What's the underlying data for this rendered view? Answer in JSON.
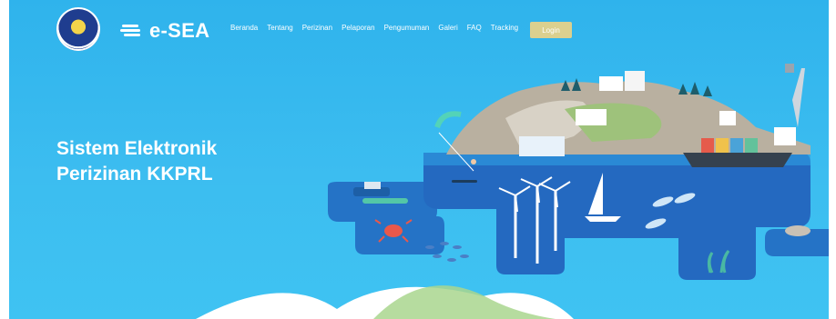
{
  "header": {
    "brand": "e-SEA",
    "nav": [
      "Beranda",
      "Tentang",
      "Perizinan",
      "Pelaporan",
      "Pengumuman",
      "Galeri",
      "FAQ",
      "Tracking"
    ],
    "login_label": "Login"
  },
  "hero": {
    "title_line1": "Sistem Elektronik",
    "title_line2": "Perizinan KKPRL"
  },
  "colors": {
    "sky": "#2fb3ec",
    "login_button": "#dbd08f",
    "sea_dark": "#2573c6",
    "sea_light": "#2d8ee0",
    "land": "#b9b0a0"
  },
  "icons": [
    "emblem-logo",
    "brand-icon"
  ]
}
